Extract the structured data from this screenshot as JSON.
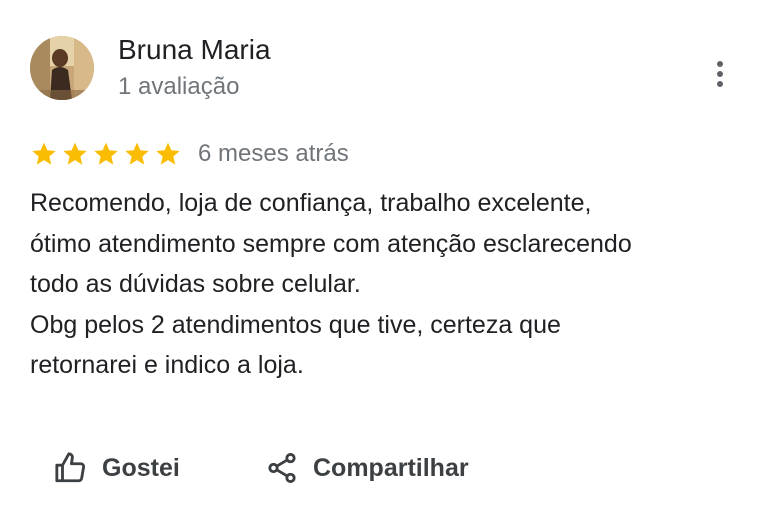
{
  "author": {
    "name": "Bruna Maria",
    "review_count": "1 avaliação"
  },
  "rating": {
    "stars": 5,
    "max_stars": 5,
    "timestamp": "6 meses atrás"
  },
  "review": {
    "lines": [
      "Recomendo, loja de confiança, trabalho excelente,",
      "ótimo atendimento sempre com atenção esclarecendo",
      "todo as dúvidas sobre celular.",
      "Obg pelos 2 atendimentos que tive, certeza que",
      "retornarei e indico a loja."
    ]
  },
  "actions": {
    "like_label": "Gostei",
    "like_icon": "thumbs-up-icon",
    "share_label": "Compartilhar",
    "share_icon": "share-icon"
  },
  "menu": {
    "icon": "more-vert-icon"
  },
  "colors": {
    "star": "#fbbc04",
    "text": "#202124",
    "secondary_text": "#70757a",
    "action_text": "#3c4043"
  }
}
